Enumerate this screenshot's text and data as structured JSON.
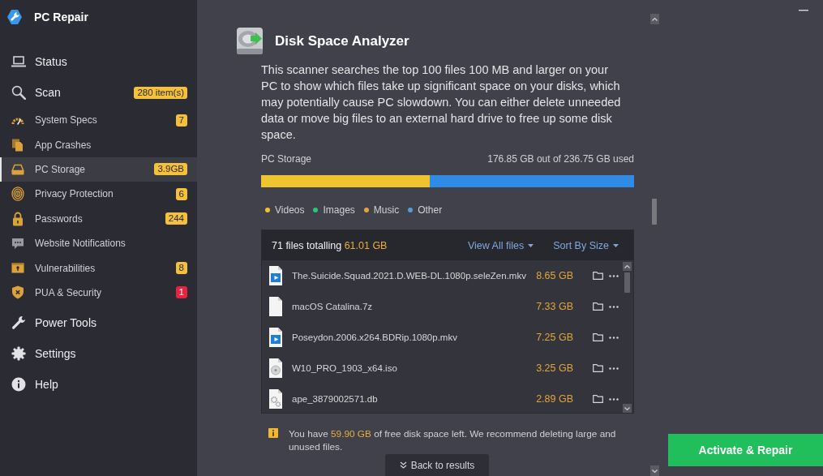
{
  "app": {
    "title": "PC Repair"
  },
  "sidebar": {
    "items": [
      {
        "label": "Status",
        "selected": false
      },
      {
        "label": "Scan",
        "selected": false,
        "badge": {
          "text": "280 item(s)",
          "color": "#f5c13a"
        },
        "children": [
          {
            "label": "System Specs",
            "selected": false,
            "badge": {
              "text": "7",
              "color": "#f5c13a"
            }
          },
          {
            "label": "App Crashes",
            "selected": false
          },
          {
            "label": "PC Storage",
            "selected": true,
            "badge": {
              "text": "3.9GB",
              "color": "#f5c13a"
            }
          },
          {
            "label": "Privacy Protection",
            "selected": false,
            "badge": {
              "text": "6",
              "color": "#f5c13a"
            }
          },
          {
            "label": "Passwords",
            "selected": false,
            "badge": {
              "text": "244",
              "color": "#f5c13a"
            }
          },
          {
            "label": "Website Notifications",
            "selected": false
          },
          {
            "label": "Vulnerabilities",
            "selected": false,
            "badge": {
              "text": "8",
              "color": "#f5c13a"
            }
          },
          {
            "label": "PUA & Security",
            "selected": false,
            "badge": {
              "text": "1",
              "color": "#e8233f"
            }
          }
        ]
      },
      {
        "label": "Power Tools",
        "selected": false
      },
      {
        "label": "Settings",
        "selected": false
      },
      {
        "label": "Help",
        "selected": false
      }
    ]
  },
  "analyzer": {
    "title": "Disk Space Analyzer",
    "description": "This scanner searches the top 100 files 100 MB and larger on your PC to show which files take up significant space on your disks, which may potentially cause PC slowdown. You can either delete unneeded data or move big files to an external hard drive to free up some disk space.",
    "storage_label": "PC Storage",
    "storage_usage": "176.85 GB out of 236.75 GB used",
    "usage_bar": [
      {
        "color": "#f0c42f",
        "level": 0.453
      },
      {
        "color": "#2f8be6",
        "level": 0.547
      }
    ],
    "legend": [
      {
        "label": "Videos",
        "color": "#f2c12e"
      },
      {
        "label": "Images",
        "color": "#2fc37a"
      },
      {
        "label": "Music",
        "color": "#e5a33a"
      },
      {
        "label": "Other",
        "color": "#5b9bd5"
      }
    ]
  },
  "file_list": {
    "summary": "71 files totalling **61.01 GB**",
    "view_filter": "View All files",
    "sort": "Sort By Size",
    "files": [
      {
        "name": "The.Suicide.Squad.2021.D.WEB-DL.1080p.seleZen.mkv",
        "size": "8.65 GB",
        "kind": "video"
      },
      {
        "name": "macOS Catalina.7z",
        "size": "7.33 GB",
        "kind": "blank"
      },
      {
        "name": "Poseydon.2006.x264.BDRip.1080p.mkv",
        "size": "7.25 GB",
        "kind": "video"
      },
      {
        "name": "W10_PRO_1903_x64.iso",
        "size": "3.25 GB",
        "kind": "disc"
      },
      {
        "name": "ape_3879002571.db",
        "size": "2.89 GB",
        "kind": "gears"
      }
    ]
  },
  "notice": {
    "text": "You have **59.90 GB** of free disk space left. We recommend deleting large and unused files."
  },
  "back_button": "Back to results",
  "activate_button": "Activate & Repair"
}
